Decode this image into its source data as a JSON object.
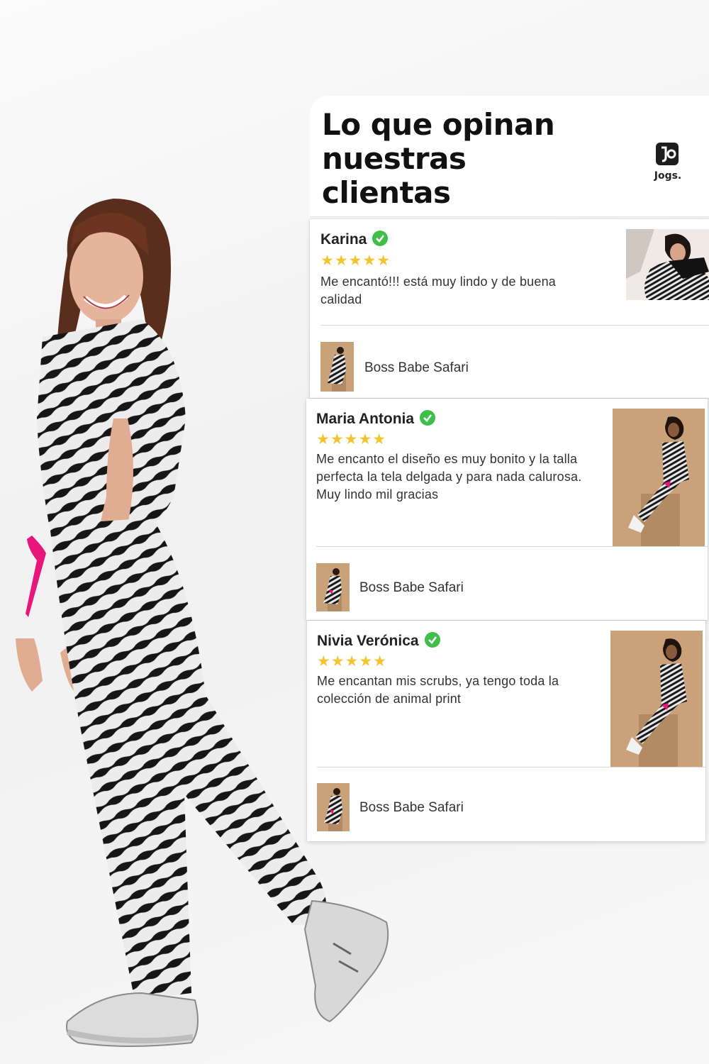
{
  "header": {
    "title_lines": [
      "Lo que opinan",
      "nuestras",
      "clientas"
    ],
    "brand_name": "Jogs."
  },
  "colors": {
    "star": "#f4c430",
    "verified": "#3fbf4a",
    "ribbon": "#e8157a",
    "photo_bg": "#c9a27a"
  },
  "reviews": [
    {
      "name": "Karina",
      "stars": "★★★★★",
      "text_lines": [
        "Me encantó!!! está muy lindo y de buena",
        "calidad"
      ],
      "product": "Boss Babe Safari"
    },
    {
      "name": "Maria Antonia",
      "stars": "★★★★★",
      "text_lines": [
        "Me encanto el diseño es muy bonito y la talla",
        "perfecta la tela delgada y para nada calurosa.",
        "Muy lindo mil gracias"
      ],
      "product": "Boss Babe Safari"
    },
    {
      "name": "Nivia Verónica",
      "stars": "★★★★★",
      "text_lines": [
        "Me encantan mis scrubs, ya tengo toda la",
        "colección de animal print"
      ],
      "product": "Boss Babe Safari"
    }
  ]
}
